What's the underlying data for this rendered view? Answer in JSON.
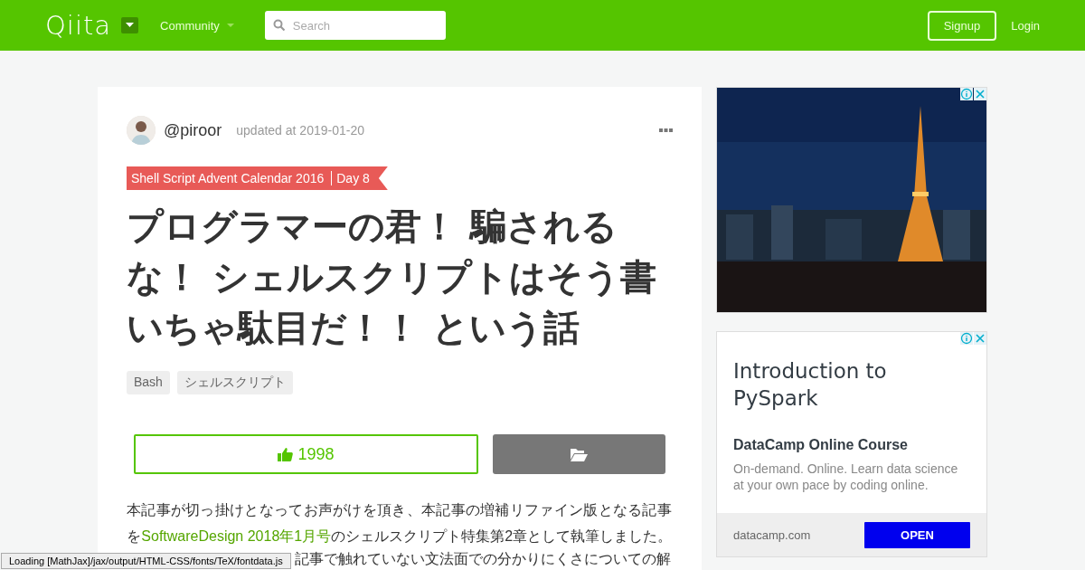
{
  "header": {
    "logo": "Qiita",
    "community": "Community",
    "search": {
      "placeholder": "Search"
    },
    "signup": "Signup",
    "login": "Login"
  },
  "article": {
    "author": "@piroor",
    "updated": "updated at 2019-01-20",
    "calendar": {
      "name": "Shell Script Advent Calendar 2016",
      "day": "Day 8"
    },
    "title": "プログラマーの君！ 騙されるな！ シェルスクリプトはそう書いちゃ駄目だ！！ という話",
    "tags": [
      "Bash",
      "シェルスクリプト"
    ],
    "likes": "1998",
    "body": {
      "before": "本記事が切っ掛けとなってお声がけを頂き、本記事の増補リファイン版となる記事を",
      "link": "SoftwareDesign 2018年1月号",
      "after": "のシェルスクリプト特集第2章として執筆しました。",
      "fragment": "記事で触れていない文法面での分かりにくさについての解"
    }
  },
  "ads": [
    {
      "kind": "picture"
    },
    {
      "kind": "text",
      "title": "Introduction to PySpark",
      "subtitle": "DataCamp Online Course",
      "description": "On-demand. Online. Learn data science at your own pace by coding online.",
      "domain": "datacamp.com",
      "button": "OPEN"
    }
  ],
  "status": "Loading [MathJax]/jax/output/HTML-CSS/fonts/TeX/fontdata.js"
}
